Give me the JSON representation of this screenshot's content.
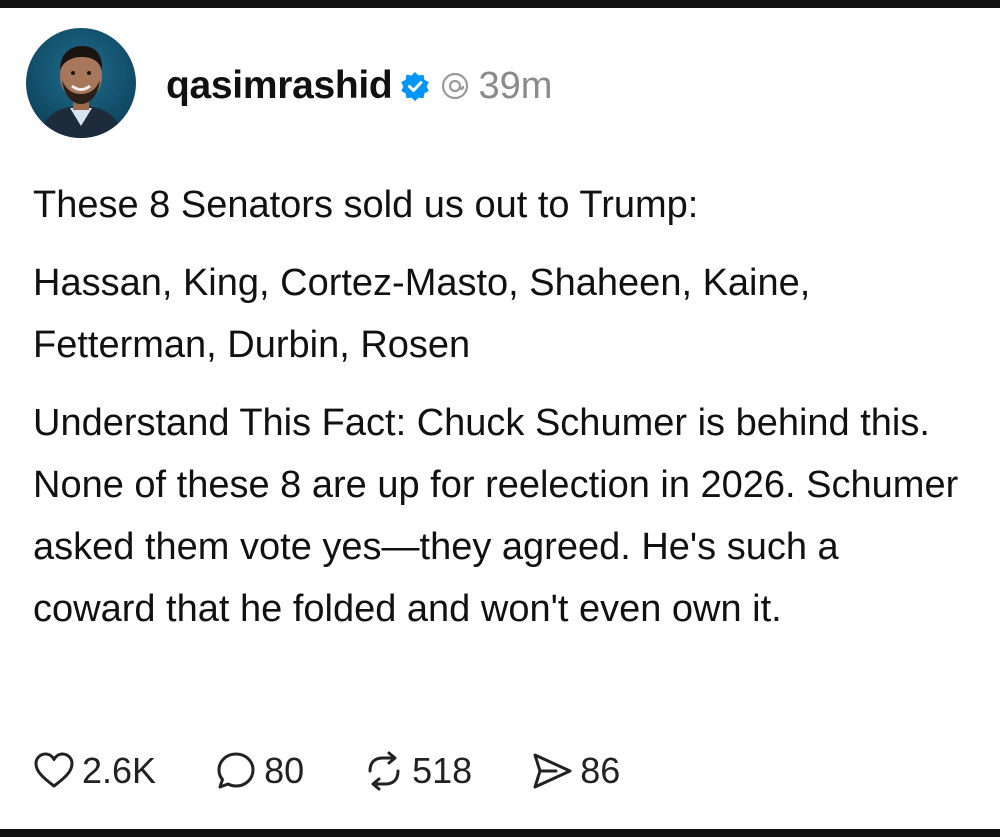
{
  "post": {
    "username": "qasimrashid",
    "timestamp": "39m",
    "paragraphs": [
      "These 8 Senators sold us out to Trump:",
      "Hassan, King, Cortez-Masto, Shaheen, Kaine, Fetterman, Durbin, Rosen",
      "Understand This Fact: Chuck Schumer is behind this. None of these 8 are up for reelection in 2026. Schumer asked them vote yes—they agreed. He's such a coward that he folded and won't even own it."
    ],
    "actions": {
      "likes": "2.6K",
      "replies": "80",
      "reposts": "518",
      "shares": "86"
    }
  },
  "icons": {
    "avatar": "profile-photo",
    "verified": "verified-badge-icon",
    "thread": "threads-icon",
    "like": "heart-icon",
    "reply": "comment-icon",
    "repost": "repost-icon",
    "share": "send-icon"
  },
  "colors": {
    "verified_blue": "#0095f6",
    "muted_text": "#8a8a8a"
  }
}
